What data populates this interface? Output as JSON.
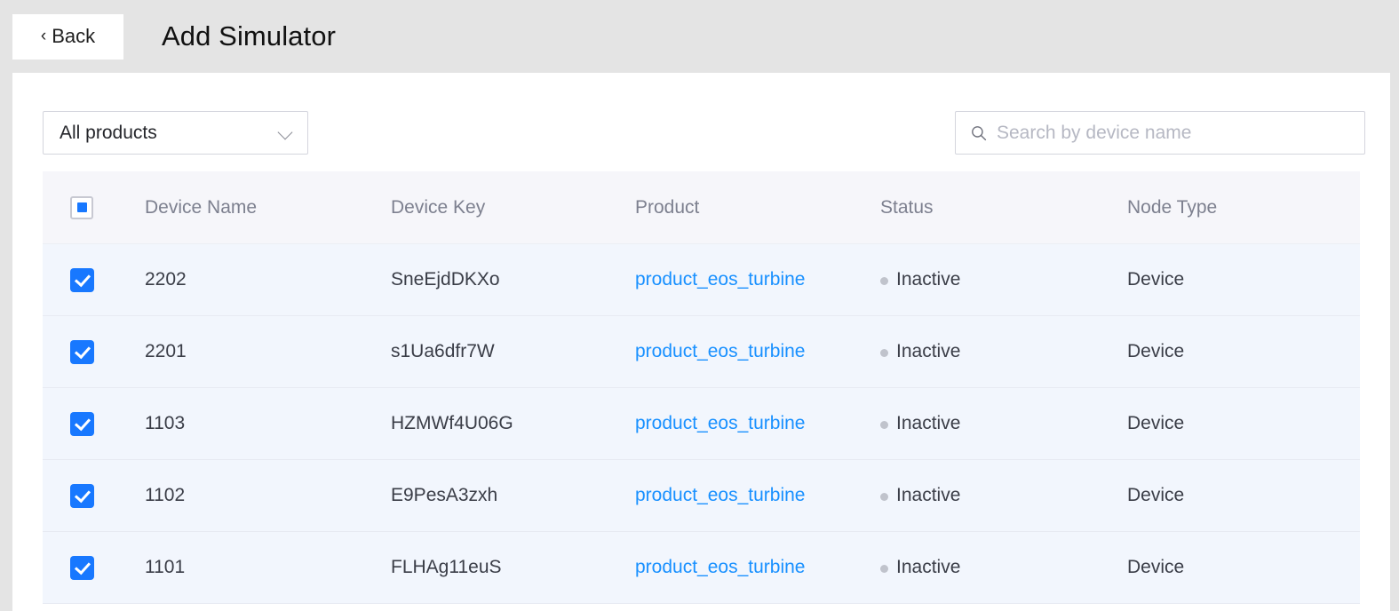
{
  "header": {
    "back_label": "Back",
    "back_chevron": "chevron-left-icon",
    "title": "Add Simulator"
  },
  "toolbar": {
    "product_filter": {
      "selected": "All products",
      "chevron": "chevron-down-icon"
    },
    "search": {
      "icon": "search-icon",
      "value": "",
      "placeholder": "Search by device name"
    }
  },
  "table": {
    "select_all_state": "indeterminate",
    "columns": [
      "Device Name",
      "Device Key",
      "Product",
      "Status",
      "Node Type"
    ],
    "rows": [
      {
        "selected": true,
        "device_name": "2202",
        "device_key": "SneEjdDKXo",
        "product": "product_eos_turbine",
        "status": "Inactive",
        "node_type": "Device"
      },
      {
        "selected": true,
        "device_name": "2201",
        "device_key": "s1Ua6dfr7W",
        "product": "product_eos_turbine",
        "status": "Inactive",
        "node_type": "Device"
      },
      {
        "selected": true,
        "device_name": "1103",
        "device_key": "HZMWf4U06G",
        "product": "product_eos_turbine",
        "status": "Inactive",
        "node_type": "Device"
      },
      {
        "selected": true,
        "device_name": "1102",
        "device_key": "E9PesA3zxh",
        "product": "product_eos_turbine",
        "status": "Inactive",
        "node_type": "Device"
      },
      {
        "selected": true,
        "device_name": "1101",
        "device_key": "FLHAg11euS",
        "product": "product_eos_turbine",
        "status": "Inactive",
        "node_type": "Device"
      }
    ]
  },
  "colors": {
    "accent": "#1878ff",
    "link": "#1890ff",
    "page_background": "#e4e4e4",
    "row_selected": "#f2f6fd",
    "header_background": "#f6f6fa",
    "status_dot": "#c0c3cc"
  }
}
